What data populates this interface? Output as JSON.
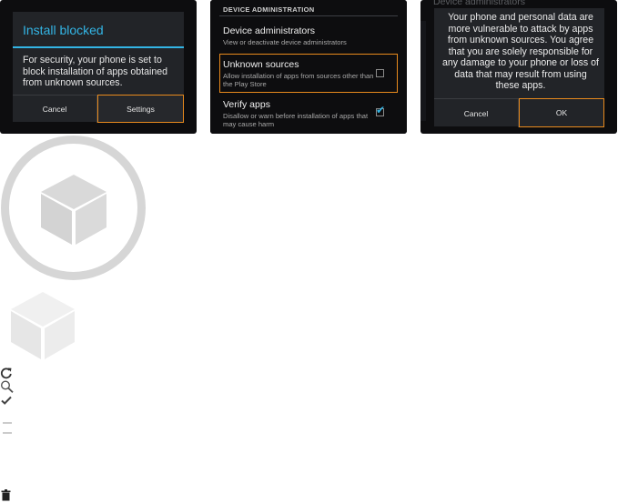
{
  "panel1": {
    "title": "Install blocked",
    "body": "For security, your phone is set to block installation of apps obtained from unknown sources.",
    "cancel_label": "Cancel",
    "settings_label": "Settings"
  },
  "panel2": {
    "section_header": "DEVICE ADMINISTRATION",
    "items": [
      {
        "title": "Device administrators",
        "subtitle": "View or deactivate device administrators",
        "checked": null
      },
      {
        "title": "Unknown sources",
        "subtitle": "Allow installation of apps from sources other than the Play Store",
        "checked": false
      },
      {
        "title": "Verify apps",
        "subtitle": "Disallow or warn before installation of apps that may cause harm",
        "checked": true
      }
    ]
  },
  "panel3": {
    "background_title": "Device administrators",
    "body": "Your phone and personal data are more vulnerable to attack by apps from unknown sources. You agree that you are solely responsible for any damage to your phone or loss of data that may result from using these apps.",
    "cancel_label": "Cancel",
    "ok_label": "OK"
  },
  "icons": {
    "large": "package-box-icon",
    "small": "package-box-icon",
    "list": [
      "refresh-icon",
      "search-icon",
      "checkmark-icon",
      "menu-lines-icon",
      "trash-icon"
    ]
  },
  "colors": {
    "accent_blue": "#33b5e5",
    "highlight_orange": "#e98a1d",
    "panel_bg": "#0d0d0f",
    "dialog_bg": "#222428",
    "icon_gray": "#d6d6d6"
  }
}
